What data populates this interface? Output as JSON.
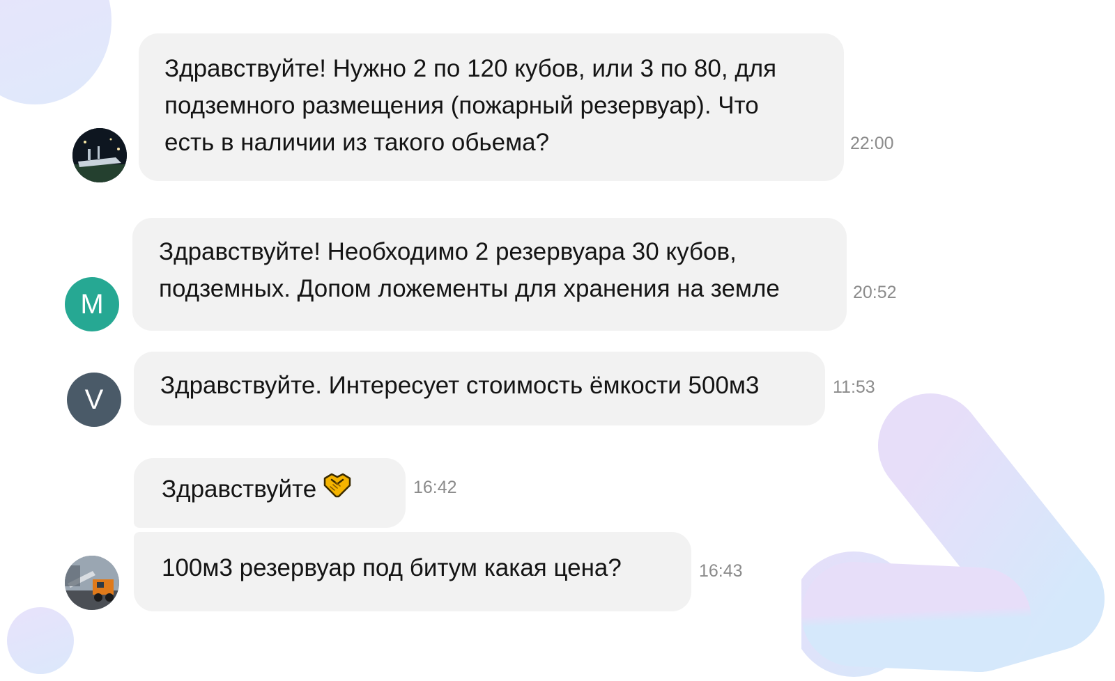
{
  "messages": [
    {
      "avatar": {
        "kind": "photo",
        "scene": "night-ship",
        "color": "#1a2533"
      },
      "text": "Здравствуйте! Нужно 2 по 120 кубов, или 3 по  80, для\nподземного размещения (пожарный резервуар). Что\nесть в наличии из такого обьема?",
      "time": "22:00"
    },
    {
      "avatar": {
        "kind": "initial",
        "letter": "M",
        "color": "#26a893"
      },
      "text": "Здравствуйте!  Необходимо 2  резервуара 30 кубов,\nподземных. Допом ложементы для хранения на земле",
      "time": "20:52"
    },
    {
      "avatar": {
        "kind": "initial",
        "letter": "V",
        "color": "#4a5a68"
      },
      "text": "Здравствуйте. Интересует стоимость ёмкости 500м3",
      "time": "11:53"
    },
    {
      "avatar": null,
      "text": "Здравствуйте",
      "emoji": "handshake-emoji",
      "time": "16:42"
    },
    {
      "avatar": {
        "kind": "photo",
        "scene": "truck-crane",
        "color": "#6b7480"
      },
      "text": "100м3 резервуар под битум какая цена?",
      "time": "16:43"
    }
  ],
  "colors": {
    "bubble": "#f2f2f2",
    "text": "#141414",
    "time": "#8b8b8b",
    "deco_start": "#e6dcfa",
    "deco_end": "#d7e9fb"
  }
}
